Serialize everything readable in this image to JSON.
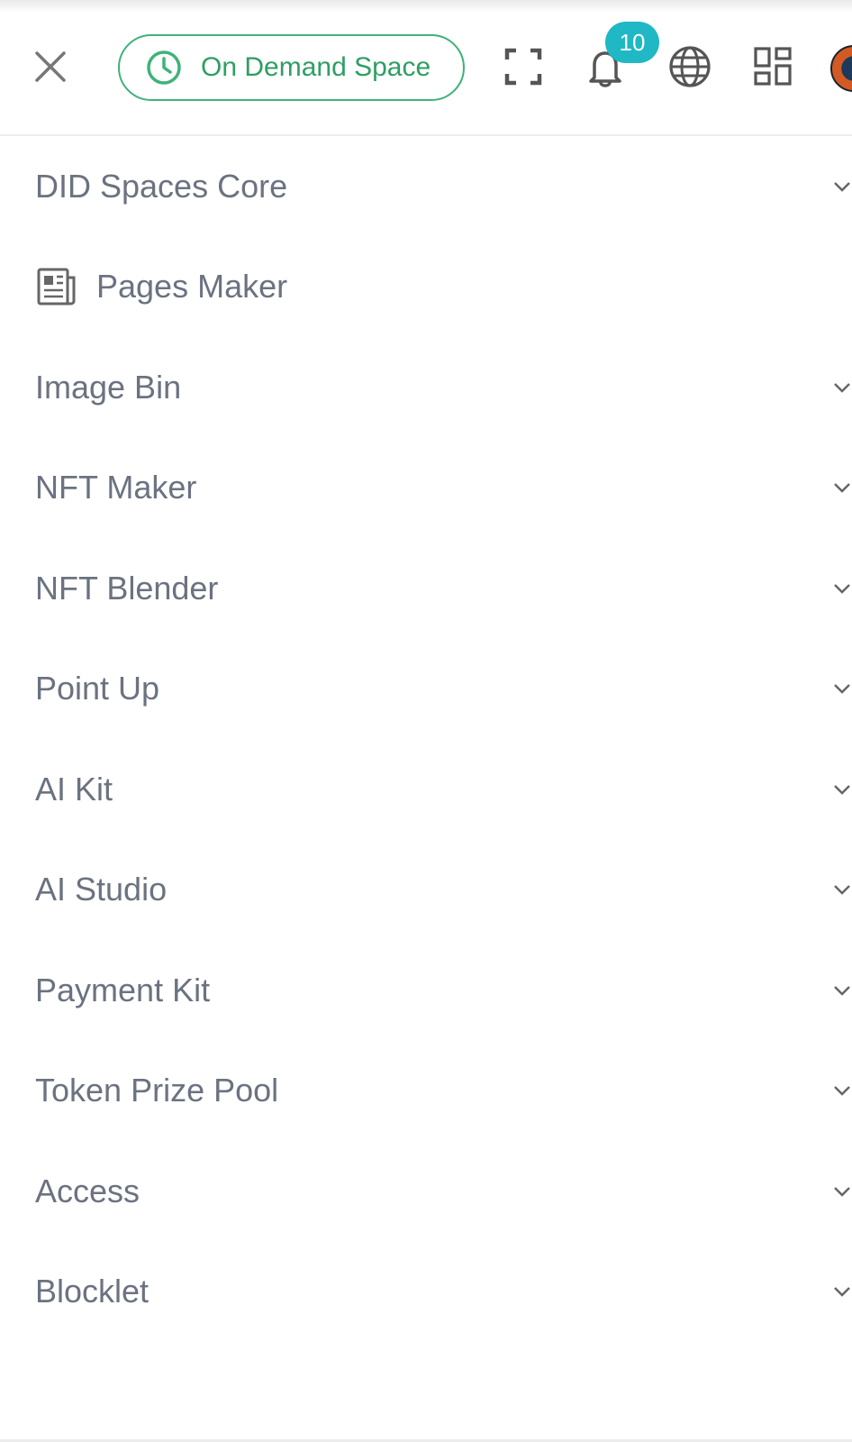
{
  "header": {
    "close_icon": "close-icon",
    "pill": {
      "label": "On Demand Space",
      "icon": "clock-icon",
      "color": "#3fb27a"
    },
    "fullscreen_icon": "fullscreen-icon",
    "notifications": {
      "icon": "bell-icon",
      "badge_count": "10",
      "badge_color": "#1fb8c4"
    },
    "language_icon": "globe-icon",
    "apps_icon": "grid-icon",
    "avatar_icon": "avatar"
  },
  "menu": {
    "items": [
      {
        "label": "DID Spaces Core",
        "expandable": true
      },
      {
        "label": "Pages Maker",
        "icon": "newspaper-icon",
        "expandable": false
      },
      {
        "label": "Image Bin",
        "expandable": true
      },
      {
        "label": "NFT Maker",
        "expandable": true
      },
      {
        "label": "NFT Blender",
        "expandable": true
      },
      {
        "label": "Point Up",
        "expandable": true
      },
      {
        "label": "AI Kit",
        "expandable": true
      },
      {
        "label": "AI Studio",
        "expandable": true
      },
      {
        "label": "Payment Kit",
        "expandable": true
      },
      {
        "label": "Token Prize Pool",
        "expandable": true
      },
      {
        "label": "Access",
        "expandable": true
      },
      {
        "label": "Blocklet",
        "expandable": true
      }
    ]
  }
}
